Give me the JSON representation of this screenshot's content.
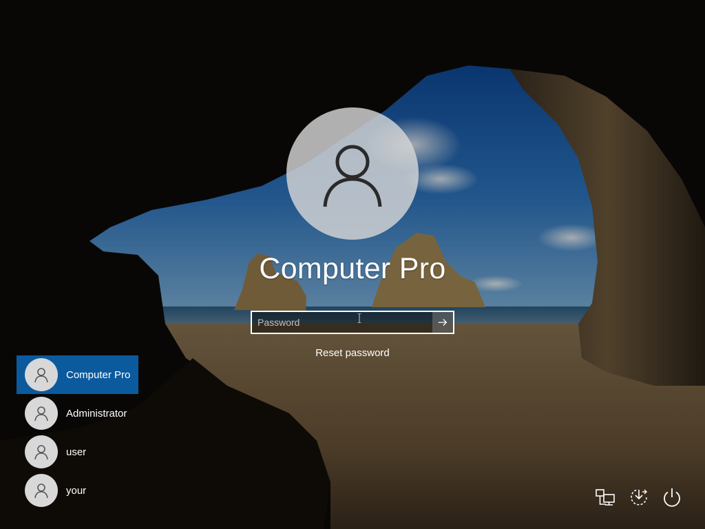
{
  "account": {
    "display_name": "Computer Pro",
    "avatar_icon": "user-silhouette-icon"
  },
  "password": {
    "placeholder": "Password",
    "value": "",
    "submit_icon": "arrow-right-icon"
  },
  "reset_password_label": "Reset password",
  "users": [
    {
      "name": "Computer Pro",
      "selected": true
    },
    {
      "name": "Administrator",
      "selected": false
    },
    {
      "name": "user",
      "selected": false
    },
    {
      "name": "your",
      "selected": false
    }
  ],
  "corner_buttons": [
    {
      "name": "network",
      "icon": "network-icon"
    },
    {
      "name": "ease-of-access",
      "icon": "ease-of-access-icon"
    },
    {
      "name": "power",
      "icon": "power-icon"
    }
  ],
  "colors": {
    "selected_user_bg": "#0b5a9e",
    "avatar_bg": "#d8d8d8",
    "text": "#ffffff"
  }
}
